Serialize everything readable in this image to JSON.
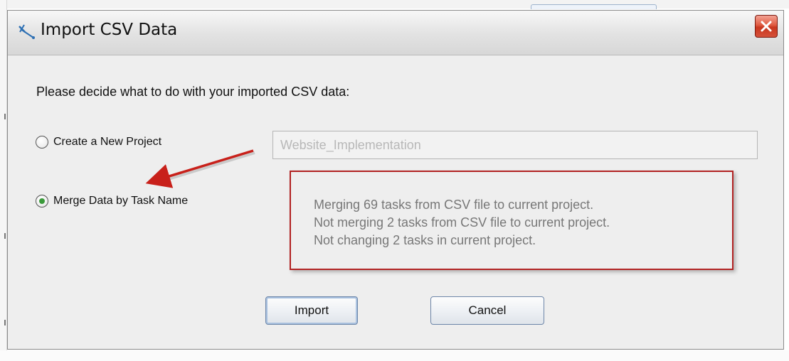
{
  "dialog": {
    "title": "Import CSV Data",
    "title_icon": "pin-icon",
    "prompt": "Please decide what to do with your imported CSV data:",
    "options": [
      {
        "label": "Create a New Project",
        "selected": false
      },
      {
        "label": "Merge Data by Task Name",
        "selected": true
      }
    ],
    "project_name_field": {
      "value": "Website_Implementation",
      "enabled": false
    },
    "merge_summary": [
      "Merging 69 tasks from CSV file to current project.",
      "Not merging 2 tasks from CSV file to current project.",
      "Not changing 2 tasks in current project."
    ],
    "buttons": {
      "import_label": "Import",
      "cancel_label": "Cancel"
    }
  },
  "annotation": {
    "highlight_color": "#b22222",
    "arrow_color": "#c8201a"
  }
}
